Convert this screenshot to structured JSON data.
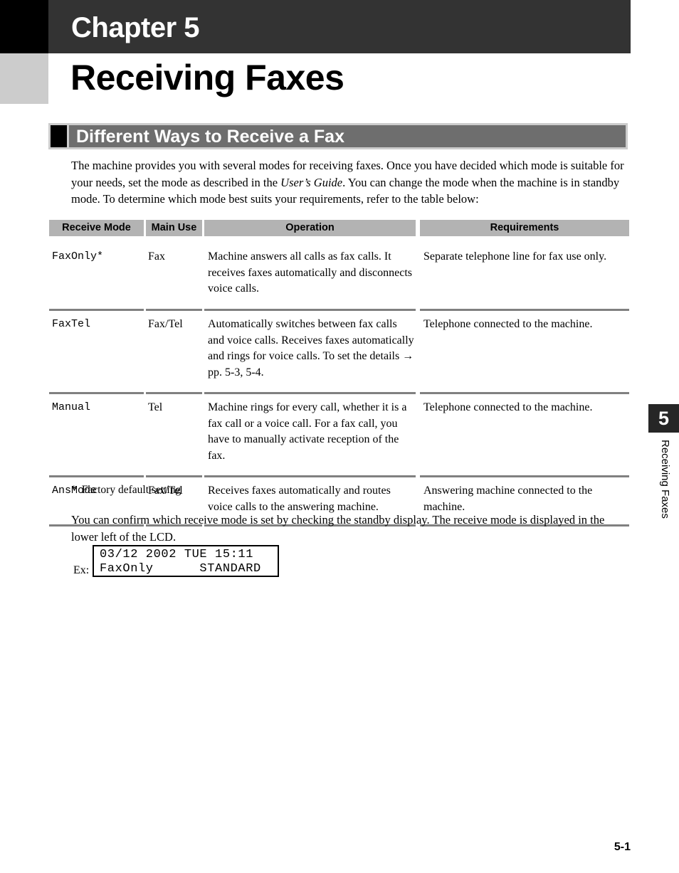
{
  "chapter": {
    "label": "Chapter 5",
    "title": "Receiving Faxes"
  },
  "section": {
    "title": "Different Ways to Receive a Fax"
  },
  "intro_paragraph": {
    "part1": "The machine provides you with several modes for receiving faxes. Once you have decided which mode is suitable for your needs, set the mode as described in the ",
    "italic": "User’s Guide",
    "part2": ". You can change the mode when the machine is in standby mode. To determine which mode best suits your requirements, refer to the table below:"
  },
  "table": {
    "headers": [
      "Receive Mode",
      "Main Use",
      "Operation",
      "Requirements"
    ],
    "rows": [
      {
        "mode": "FaxOnly*",
        "main_use": "Fax",
        "operation": "Machine answers all calls as fax calls. It receives faxes automatically and disconnects voice calls.",
        "requirements": "Separate telephone line for fax use only."
      },
      {
        "mode": "FaxTel",
        "main_use": "Fax/Tel",
        "operation": "Automatically switches between fax calls and voice calls. Receives faxes automatically and rings for voice calls. To set the details → pp. 5-3, 5-4.",
        "requirements": "Telephone connected to the machine."
      },
      {
        "mode": "Manual",
        "main_use": "Tel",
        "operation": "Machine rings for every call, whether it is a fax call or a voice call. For a fax call, you have to manually activate reception of the fax.",
        "requirements": "Telephone connected to the machine."
      },
      {
        "mode": "AnsMode",
        "main_use": "Fax/Tel",
        "operation": "Receives faxes automatically and routes voice calls to the answering machine.",
        "requirements": "Answering machine connected to the machine."
      }
    ]
  },
  "footnote": {
    "mark": "*",
    "text": "Factory default setting"
  },
  "confirm_paragraph": "You can confirm which receive mode is set by checking the standby display. The receive mode is displayed in the lower left of the LCD.",
  "lcd_example": {
    "label": "Ex:",
    "line1": "03/12 2002 TUE 15:11",
    "line2": "FaxOnly      STANDARD"
  },
  "side_tab": {
    "number": "5",
    "text": "Receiving Faxes"
  },
  "footer": {
    "page_number": "5-1"
  },
  "colors": {
    "banner_dark": "#333333",
    "banner_black": "#000000",
    "title_block_gray": "#cccccc",
    "section_bar_gray": "#6e6e6e",
    "section_bar_border": "#cccccc",
    "table_header_gray": "#b3b3b3",
    "rule_gray": "#808080",
    "side_tab_dark": "#262626"
  }
}
